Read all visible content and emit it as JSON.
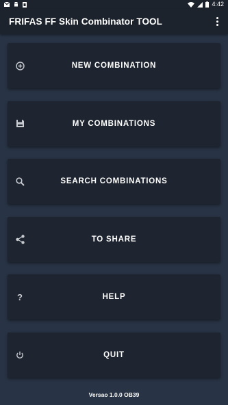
{
  "status_bar": {
    "time": "4:42",
    "icons": [
      "gmail-icon",
      "android-icon",
      "notification-icon",
      "wifi-icon",
      "signal-icon",
      "battery-icon"
    ]
  },
  "app_bar": {
    "title": "FRIFAS FF Skin Combinator TOOL",
    "menu_icon": "more-vert-icon"
  },
  "menu": [
    {
      "label": "NEW COMBINATION",
      "icon": "add-circle-icon"
    },
    {
      "label": "MY COMBINATIONS",
      "icon": "save-icon"
    },
    {
      "label": "SEARCH COMBINATIONS",
      "icon": "search-icon"
    },
    {
      "label": "TO SHARE",
      "icon": "share-icon"
    },
    {
      "label": "HELP",
      "icon": "help-icon"
    },
    {
      "label": "QUIT",
      "icon": "power-icon"
    }
  ],
  "footer": {
    "version": "Versao 1.0.0 OB39"
  },
  "colors": {
    "background": "#283445",
    "bar": "#1c232d",
    "button": "#1e2530",
    "text": "#ffffff"
  }
}
